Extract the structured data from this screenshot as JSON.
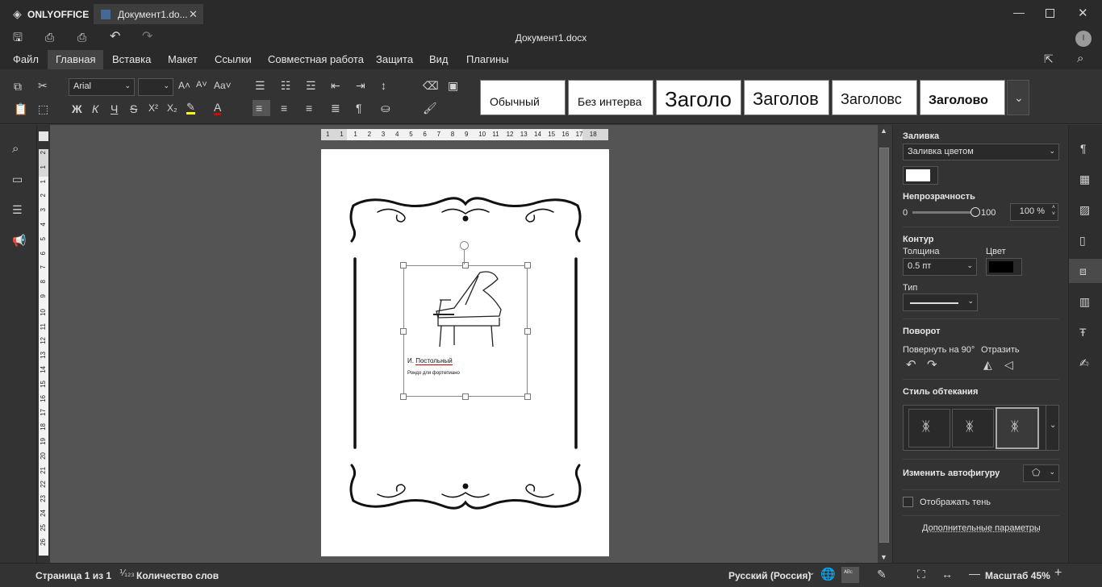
{
  "app": {
    "brand": "ONLYOFFICE",
    "tab_title": "Документ1.do...",
    "doc_title": "Документ1.docx",
    "user_initial": "I"
  },
  "menu": [
    "Файл",
    "Главная",
    "Вставка",
    "Макет",
    "Ссылки",
    "Совместная работа",
    "Защита",
    "Вид",
    "Плагины"
  ],
  "menu_active": "Главная",
  "ribbon": {
    "font_name": "Arial",
    "font_size": "",
    "styles": [
      "Обычный",
      "Без интерва",
      "Заголо",
      "Заголов",
      "Заголовс",
      "Заголово"
    ]
  },
  "document": {
    "author_prefix": "И.",
    "author_name": "Постольный",
    "subtitle": "Рондо для фортепиано"
  },
  "ruler_h": [
    "1",
    "1",
    "1",
    "2",
    "3",
    "4",
    "5",
    "6",
    "7",
    "8",
    "9",
    "10",
    "11",
    "12",
    "13",
    "14",
    "15",
    "16",
    "17",
    "18"
  ],
  "ruler_v": [
    "2",
    "1",
    "1",
    "2",
    "3",
    "4",
    "5",
    "6",
    "7",
    "8",
    "9",
    "10",
    "11",
    "12",
    "13",
    "14",
    "15",
    "16",
    "17",
    "18",
    "19",
    "20",
    "21",
    "22",
    "23",
    "24",
    "25",
    "26"
  ],
  "panel": {
    "fill_title": "Заливка",
    "fill_type": "Заливка цветом",
    "opacity_title": "Непрозрачность",
    "opacity_min": "0",
    "opacity_max": "100",
    "opacity_value": "100 %",
    "opacity_level": 1.0,
    "outline_title": "Контур",
    "thickness_label": "Толщина",
    "thickness_value": "0.5 пт",
    "color_label": "Цвет",
    "type_label": "Тип",
    "rotation_title": "Поворот",
    "rotate90_label": "Повернуть на 90°",
    "flip_label": "Отразить",
    "wrap_title": "Стиль обтекания",
    "change_shape_label": "Изменить автофигуру",
    "shadow_label": "Отображать тень",
    "advanced_link": "Дополнительные параметры"
  },
  "status": {
    "page": "Страница 1 из 1",
    "word_count": "Количество слов",
    "language": "Русский (Россия)",
    "zoom": "Масштаб 45%"
  },
  "colors": {
    "fill": "#ffffff",
    "outline": "#000000",
    "accent": "#c00000"
  }
}
